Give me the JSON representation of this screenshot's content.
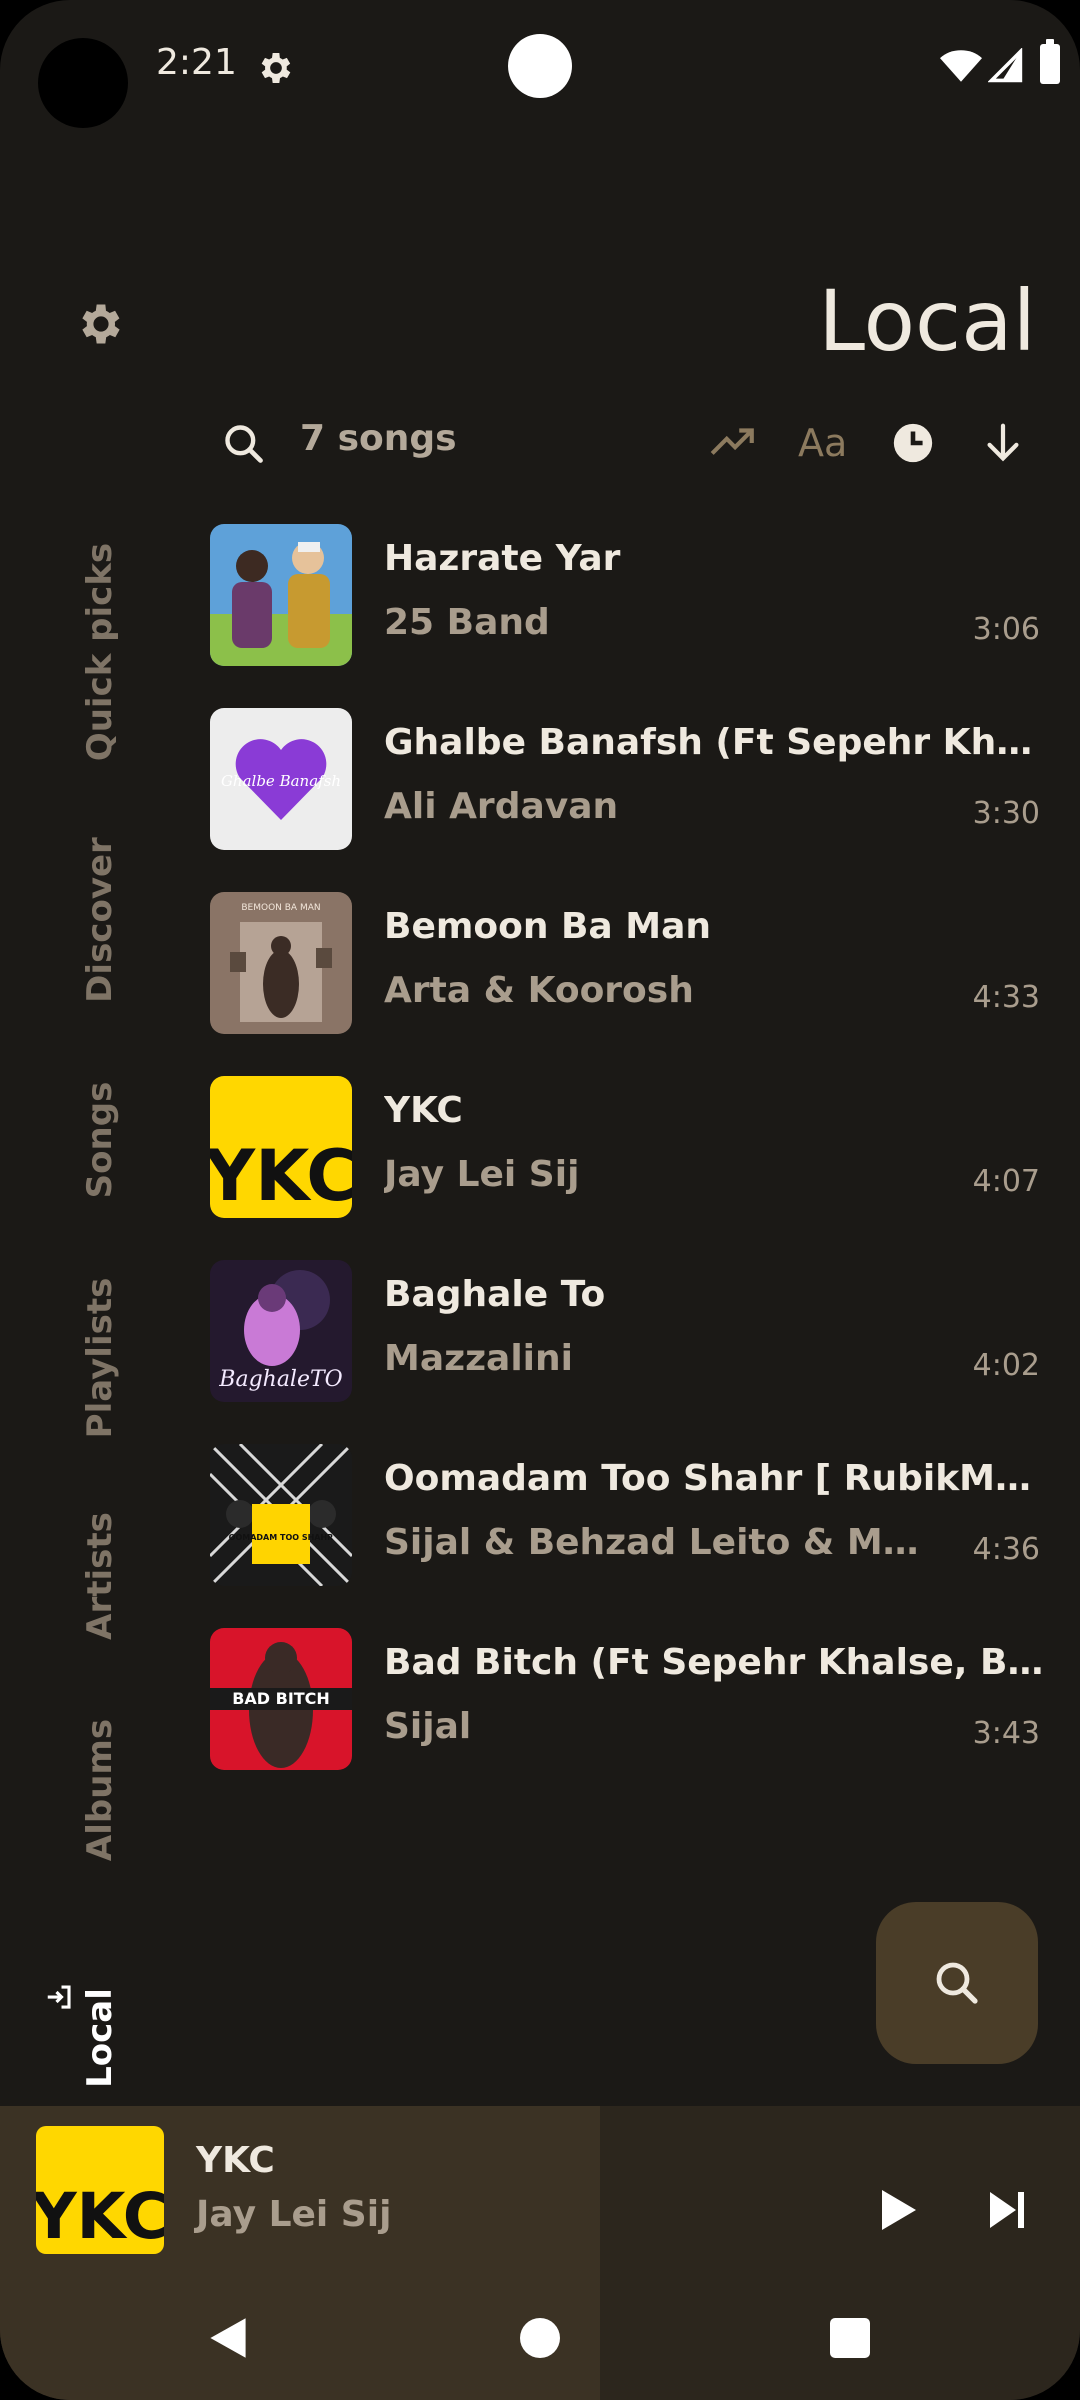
{
  "status_bar": {
    "time": "2:21"
  },
  "header": {
    "title": "Local",
    "song_count": "7 songs",
    "sort_alpha_label": "Aa"
  },
  "nav": [
    {
      "label": "Quick picks"
    },
    {
      "label": "Discover"
    },
    {
      "label": "Songs"
    },
    {
      "label": "Playlists"
    },
    {
      "label": "Artists"
    },
    {
      "label": "Albums"
    },
    {
      "label": "Local",
      "active": true
    }
  ],
  "songs": [
    {
      "title": "Hazrate Yar",
      "artist": "25 Band",
      "duration": "3:06"
    },
    {
      "title": "Ghalbe Banafsh (Ft Sepehr Khalse…",
      "artist": "Ali Ardavan",
      "duration": "3:30"
    },
    {
      "title": "Bemoon Ba Man",
      "artist": "Arta & Koorosh",
      "duration": "4:33"
    },
    {
      "title": "YKC",
      "artist": "Jay Lei Sij",
      "duration": "4:07"
    },
    {
      "title": "Baghale To",
      "artist": "Mazzalini",
      "duration": "4:02"
    },
    {
      "title": "Oomadam Too Shahr [ RubikMusi…",
      "artist": "Sijal & Behzad Leito & Mehra…",
      "duration": "4:36"
    },
    {
      "title": "Bad Bitch (Ft Sepehr Khalse, Behz…",
      "artist": "Sijal",
      "duration": "3:43"
    }
  ],
  "art_labels": {
    "ghalbe": "Ghalbe Banafsh",
    "bemoon": "BEMOON BA MAN",
    "ykc": "YKC",
    "baghale": "BaghaleTO",
    "oomadam": "OOMADAM TOO SHAHR",
    "badbitch": "BAD BITCH"
  },
  "player": {
    "title": "YKC",
    "artist": "Jay Lei Sij"
  },
  "colors": {
    "background": "#1b1916",
    "accent": "#4a3d28",
    "nav_inactive": "#7f7466"
  }
}
